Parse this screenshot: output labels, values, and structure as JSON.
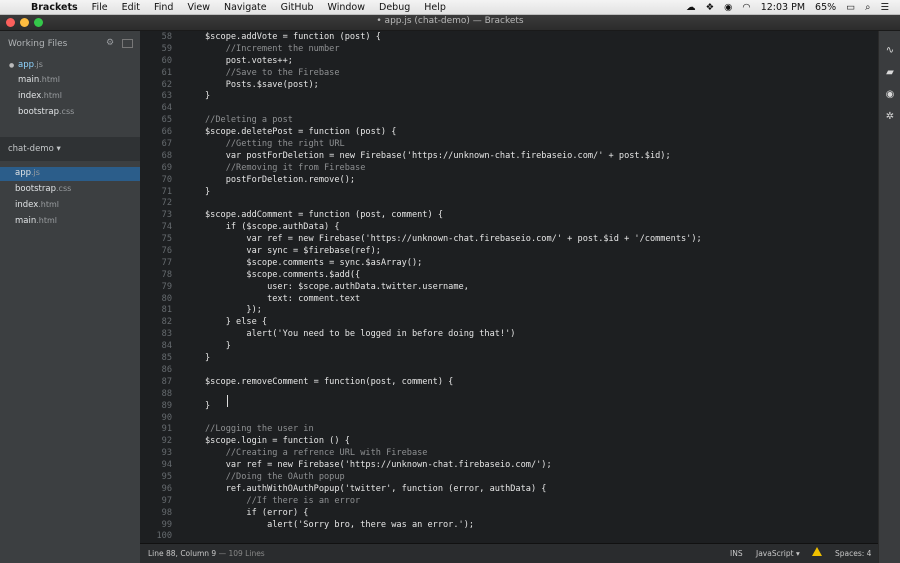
{
  "menubar": {
    "app_name": "Brackets",
    "items": [
      "File",
      "Edit",
      "Find",
      "View",
      "Navigate",
      "GitHub",
      "Window",
      "Debug",
      "Help"
    ],
    "time": "12:03 PM",
    "battery": "65%"
  },
  "window": {
    "title": "• app.js (chat-demo) — Brackets"
  },
  "sidebar": {
    "working_files_label": "Working Files",
    "working_files": [
      {
        "name": "app",
        "ext": ".js",
        "active": true
      },
      {
        "name": "main",
        "ext": ".html"
      },
      {
        "name": "index",
        "ext": ".html"
      },
      {
        "name": "bootstrap",
        "ext": ".css"
      }
    ],
    "project_label": "chat-demo ▾",
    "project_files": [
      {
        "name": "app",
        "ext": ".js"
      },
      {
        "name": "bootstrap",
        "ext": ".css"
      },
      {
        "name": "index",
        "ext": ".html"
      },
      {
        "name": "main",
        "ext": ".html"
      }
    ]
  },
  "editor": {
    "lines": [
      {
        "n": "58",
        "text": "$scope.addVote = function (post) {"
      },
      {
        "n": "59",
        "text": "    //Increment the number"
      },
      {
        "n": "60",
        "text": "    post.votes++;"
      },
      {
        "n": "61",
        "text": "    //Save to the Firebase"
      },
      {
        "n": "62",
        "text": "    Posts.$save(post);"
      },
      {
        "n": "63",
        "text": "}"
      },
      {
        "n": "64",
        "text": ""
      },
      {
        "n": "65",
        "text": "//Deleting a post"
      },
      {
        "n": "66",
        "text": "$scope.deletePost = function (post) {"
      },
      {
        "n": "67",
        "text": "    //Getting the right URL"
      },
      {
        "n": "68",
        "text": "    var postForDeletion = new Firebase('https://unknown-chat.firebaseio.com/' + post.$id);"
      },
      {
        "n": "69",
        "text": "    //Removing it from Firebase"
      },
      {
        "n": "70",
        "text": "    postForDeletion.remove();"
      },
      {
        "n": "71",
        "text": "}"
      },
      {
        "n": "72",
        "text": ""
      },
      {
        "n": "73",
        "text": "$scope.addComment = function (post, comment) {"
      },
      {
        "n": "74",
        "text": "    if ($scope.authData) {"
      },
      {
        "n": "75",
        "text": "        var ref = new Firebase('https://unknown-chat.firebaseio.com/' + post.$id + '/comments');"
      },
      {
        "n": "76",
        "text": "        var sync = $firebase(ref);"
      },
      {
        "n": "77",
        "text": "        $scope.comments = sync.$asArray();"
      },
      {
        "n": "78",
        "text": "        $scope.comments.$add({"
      },
      {
        "n": "79",
        "text": "            user: $scope.authData.twitter.username,"
      },
      {
        "n": "80",
        "text": "            text: comment.text"
      },
      {
        "n": "81",
        "text": "        });"
      },
      {
        "n": "82",
        "text": "    } else {"
      },
      {
        "n": "83",
        "text": "        alert('You need to be logged in before doing that!')"
      },
      {
        "n": "84",
        "text": "    }"
      },
      {
        "n": "85",
        "text": "}"
      },
      {
        "n": "86",
        "text": ""
      },
      {
        "n": "87",
        "text": "$scope.removeComment = function(post, comment) {"
      },
      {
        "n": "88",
        "text": ""
      },
      {
        "n": "89",
        "text": "}"
      },
      {
        "n": "90",
        "text": ""
      },
      {
        "n": "91",
        "text": "//Logging the user in"
      },
      {
        "n": "92",
        "text": "$scope.login = function () {"
      },
      {
        "n": "93",
        "text": "    //Creating a refrence URL with Firebase"
      },
      {
        "n": "94",
        "text": "    var ref = new Firebase('https://unknown-chat.firebaseio.com/');"
      },
      {
        "n": "95",
        "text": "    //Doing the OAuth popup"
      },
      {
        "n": "96",
        "text": "    ref.authWithOAuthPopup('twitter', function (error, authData) {"
      },
      {
        "n": "97",
        "text": "        //If there is an error"
      },
      {
        "n": "98",
        "text": "        if (error) {"
      },
      {
        "n": "99",
        "text": "            alert('Sorry bro, there was an error.');"
      },
      {
        "n": "100",
        "text": ""
      }
    ]
  },
  "statusbar": {
    "position": "Line 88, Column 9",
    "line_count": "— 109 Lines",
    "mode": "INS",
    "language": "JavaScript ▾",
    "spaces": "Spaces: 4"
  },
  "colors": {
    "comment": "#8e9092",
    "keyword": "#cfa9ff",
    "string": "#f0e68c",
    "property": "#8fd4ff"
  }
}
